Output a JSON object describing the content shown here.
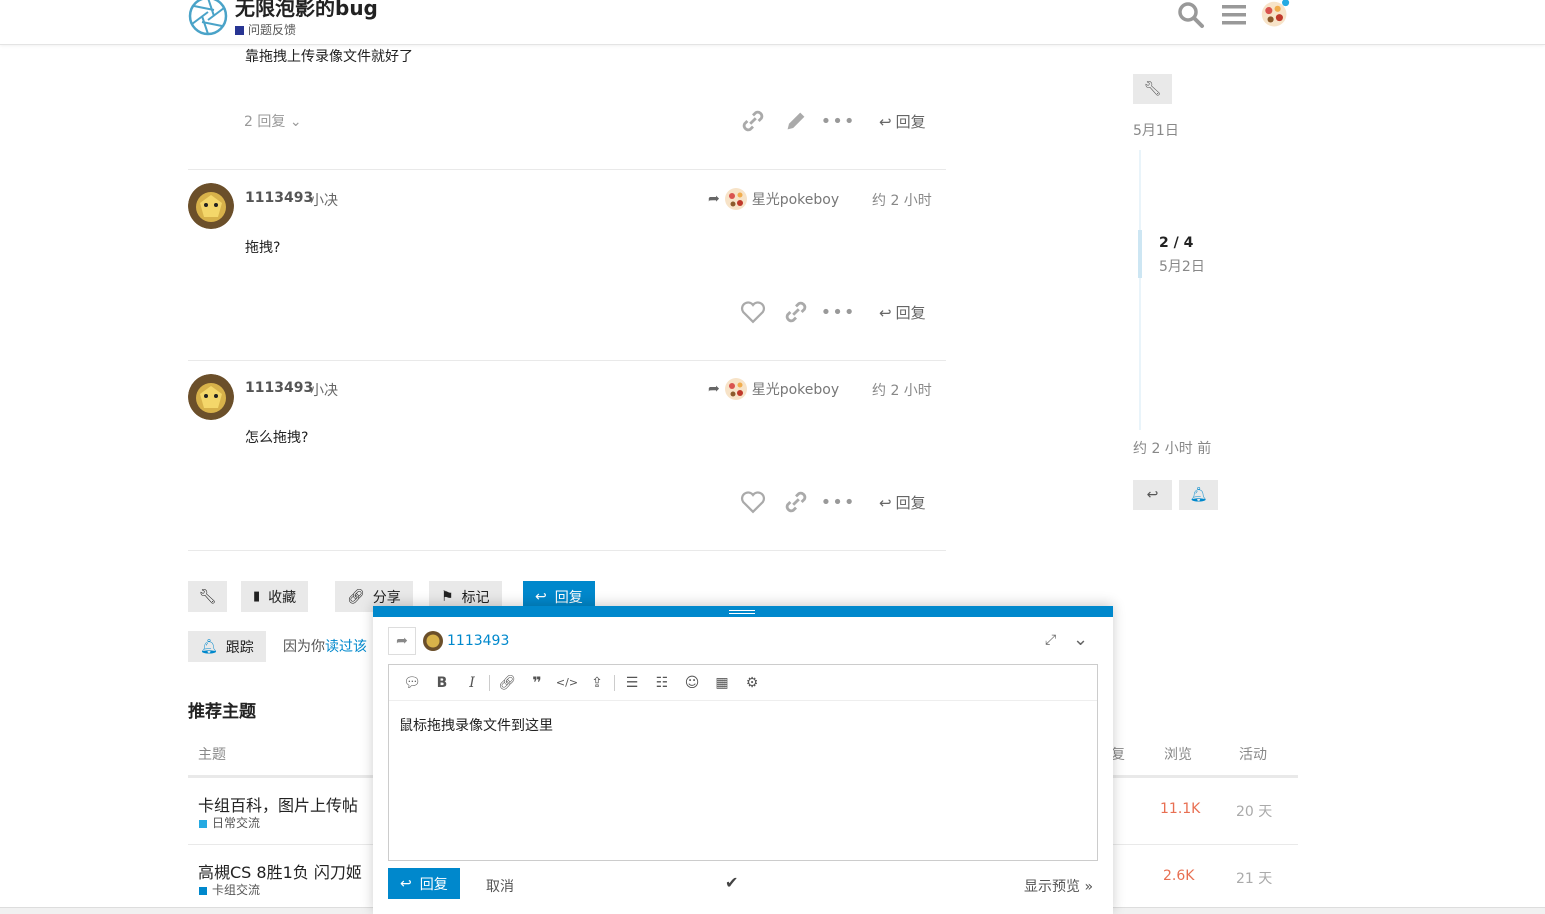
{
  "header": {
    "site_title": "无限泡影的bug",
    "category": "问题反馈",
    "category_color": "#283593"
  },
  "posts": [
    {
      "body": "靠拖拽上传录像文件就好了",
      "replies_label": "2 回复",
      "reply_label": "回复"
    },
    {
      "username": "1113493",
      "fullname": "小决",
      "reply_to": "星光pokeboy",
      "time": "约 2 小时",
      "body": "拖拽?",
      "reply_label": "回复"
    },
    {
      "username": "1113493",
      "fullname": "小决",
      "reply_to": "星光pokeboy",
      "time": "约 2 小时",
      "body": "怎么拖拽?",
      "reply_label": "回复"
    }
  ],
  "topic_buttons": {
    "bookmark": "收藏",
    "share": "分享",
    "flag": "标记",
    "reply": "回复"
  },
  "notification": {
    "button": "跟踪",
    "reason_prefix": "因为你",
    "reason_link": "读过该"
  },
  "suggested": {
    "title": "推荐主题",
    "col_topic": "主题",
    "col_replies": "复",
    "col_views": "浏览",
    "col_activity": "活动",
    "topics": [
      {
        "title": "卡组百科，图片上传帖",
        "category": "日常交流",
        "views": "11.1K",
        "activity": "20 天"
      },
      {
        "title": "高槻CS 8胜1负 闪刀姬",
        "category": "卡组交流",
        "views": "2.6K",
        "activity": "21 天"
      }
    ]
  },
  "timeline": {
    "start_date": "5月1日",
    "position": "2 / 4",
    "position_date": "5月2日",
    "end_label": "约 2 小时 前"
  },
  "composer": {
    "reply_to_user": "1113493",
    "editor_text": "鼠标拖拽录像文件到这里",
    "submit_label": "回复",
    "cancel_label": "取消",
    "preview_label": "显示预览 »"
  },
  "colors": {
    "accent": "#0088cc",
    "views": "#e45735"
  }
}
